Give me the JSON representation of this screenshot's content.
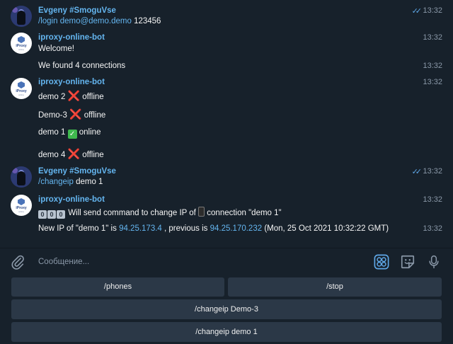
{
  "messages": [
    {
      "sender": "Evgeny #SmoguVse",
      "time": "13:32",
      "read": "✓✓",
      "command": "/login",
      "email": "demo@demo.demo",
      "rest": " 123456"
    },
    {
      "sender": "iproxy-online-bot",
      "time": "13:32",
      "text": "Welcome!"
    },
    {
      "time": "13:32",
      "text": "We found 4 connections"
    },
    {
      "sender": "iproxy-online-bot",
      "time": "13:32",
      "lines": [
        {
          "name": "demo 2",
          "status": "offline",
          "emoji": "❌"
        },
        {
          "name": "Demo-3",
          "status": "offline",
          "emoji": "❌"
        },
        {
          "name": "demo 1",
          "status": "online",
          "emoji": "✅"
        },
        {
          "name": "demo 4",
          "status": "offline",
          "emoji": "❌"
        }
      ]
    },
    {
      "sender": "Evgeny #SmoguVse",
      "time": "13:32",
      "read": "✓✓",
      "command": "/changeip",
      "rest": " demo 1"
    },
    {
      "sender": "iproxy-online-bot",
      "time": "13:32",
      "digits": [
        "0",
        "0",
        "0"
      ],
      "text_a": " Will send command to change IP of ",
      "text_b": " connection \"demo 1\""
    },
    {
      "time": "13:32",
      "ip_prefix": "New IP of \"demo 1\" is ",
      "new_ip": "94.25.173.4",
      "ip_mid": " , previous is ",
      "old_ip": "94.25.170.232",
      "ip_suffix": " (Mon, 25 Oct 2021 10:32:22 GMT)"
    }
  ],
  "avatar": {
    "bot_label": "iProxy",
    "bot_sub": "online"
  },
  "composer": {
    "placeholder": "Сообщение..."
  },
  "keyboard": [
    "/phones",
    "/stop",
    "/changeip Demo-3",
    "/changeip demo 1"
  ]
}
